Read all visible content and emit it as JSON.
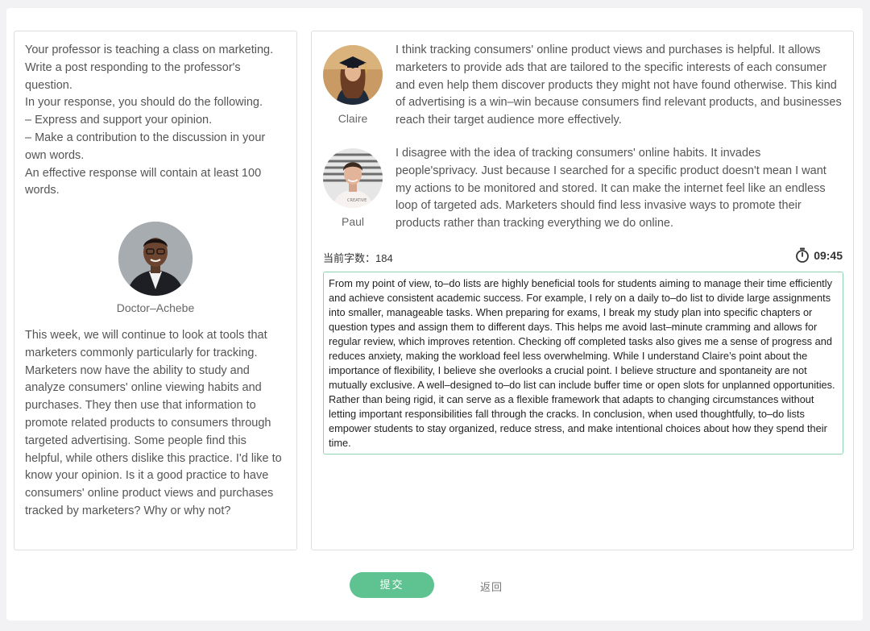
{
  "prompt": {
    "lines": [
      "Your professor is teaching a class on marketing. Write a post responding to the professor's question.",
      "In your response, you should do the following.",
      "– Express and support your opinion.",
      "– Make a contribution to the discussion in your own words.",
      "An effective response will contain at least 100 words."
    ]
  },
  "professor": {
    "name": "Doctor–Achebe",
    "text": "This week, we will continue to look at tools that marketers commonly particularly for tracking. Marketers now have the ability to study and analyze consumers' online viewing habits and purchases. They then use that information to promote related products to consumers through targeted advertising. Some people find this helpful, while others dislike this practice. I'd like to know your opinion. Is it a good practice to have consumers' online product views and purchases tracked by marketers? Why or why not?"
  },
  "students": [
    {
      "name": "Claire",
      "post": "I think tracking consumers' online product views and purchases is helpful. It allows marketers to provide ads that are tailored to the specific interests of each consumer and even help them discover products they might not have found otherwise. This kind of advertising is a win–win because consumers find relevant products, and businesses reach their target audience more effectively."
    },
    {
      "name": "Paul",
      "post": "I disagree with the idea of tracking consumers' online habits. It invades people'sprivacy. Just because I searched for a specific product doesn't mean I want my actions to be monitored and stored. It can make the internet feel like an endless loop of targeted ads. Marketers should find less invasive ways to promote their products rather than tracking everything we do online."
    }
  ],
  "editor": {
    "word_count_label": "当前字数：184",
    "timer": "09:45",
    "answer": "From my point of view, to–do lists are highly beneficial tools for students aiming to manage their time efficiently and achieve consistent academic success. For example, I rely on a daily to–do list to divide large assignments into smaller, manageable tasks. When preparing for exams, I break my study plan into specific chapters or question types and assign them to different days. This helps me avoid last–minute cramming and allows for regular review, which improves retention. Checking off completed tasks also gives me a sense of progress and reduces anxiety, making the workload feel less overwhelming. While I understand Claire’s point about the importance of flexibility, I believe she overlooks a crucial point. I believe structure and spontaneity are not mutually exclusive. A well–designed to–do list can include buffer time or open slots for unplanned opportunities. Rather than being rigid, it can serve as a flexible framework that adapts to changing circumstances without letting important responsibilities fall through the cracks. In conclusion, when used thoughtfully, to–do lists empower students to stay organized, reduce stress, and make intentional choices about how they spend their time."
  },
  "actions": {
    "submit_label": "提交",
    "back_label": "返回"
  },
  "colors": {
    "accent": "#5fc291",
    "editor_border": "#8fd4b0"
  },
  "icons": {
    "timer": "stopwatch-icon"
  }
}
